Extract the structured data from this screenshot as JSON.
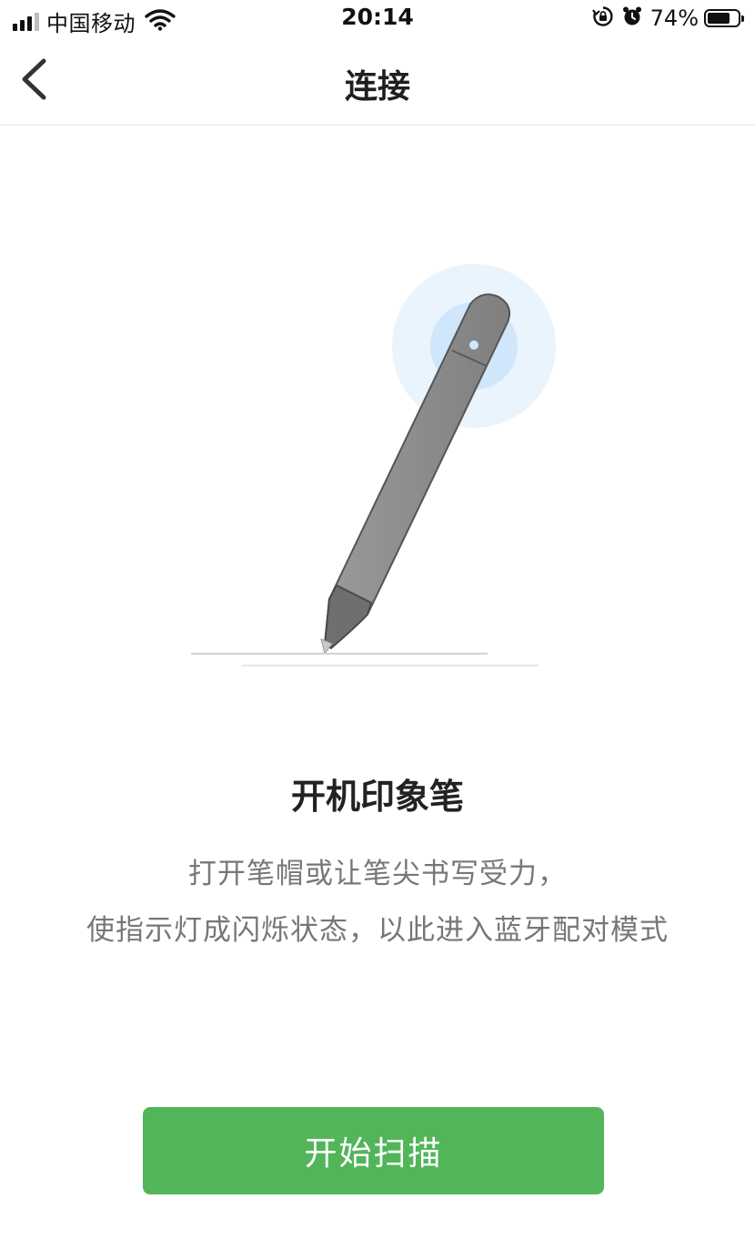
{
  "status_bar": {
    "carrier": "中国移动",
    "time": "20:14",
    "battery_percent": "74%",
    "battery_level": 0.74,
    "icons": [
      "signal-icon",
      "wifi-icon",
      "rotation-lock-icon",
      "alarm-icon",
      "battery-icon"
    ]
  },
  "nav": {
    "title": "连接",
    "back_icon": "chevron-left-icon"
  },
  "illustration": {
    "subject": "pen-icon",
    "glow_color": "#cfe6fb",
    "pen_color": "#8e8e8e"
  },
  "content": {
    "heading": "开机印象笔",
    "description_line1": "打开笔帽或让笔尖书写受力，",
    "description_line2": "使指示灯成闪烁状态，以此进入蓝牙配对模式"
  },
  "actions": {
    "scan_label": "开始扫描",
    "scan_color": "#52b55a"
  }
}
